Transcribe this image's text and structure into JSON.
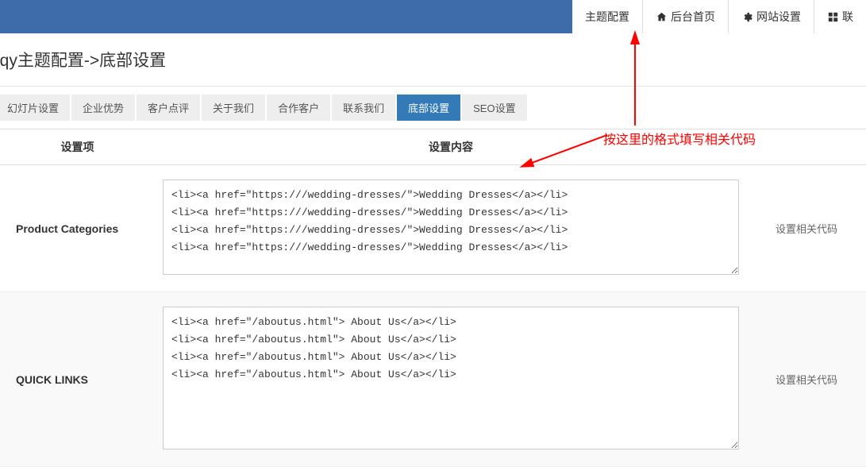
{
  "topTabs": [
    {
      "label": "主题配置",
      "icon": ""
    },
    {
      "label": "后台首页",
      "icon": "home"
    },
    {
      "label": "网站设置",
      "icon": "gear"
    },
    {
      "label": "联",
      "icon": "grid"
    }
  ],
  "pageTitle": "iqy主题配置->底部设置",
  "settingTabs": [
    {
      "label": "幻灯片设置",
      "active": false
    },
    {
      "label": "企业优势",
      "active": false
    },
    {
      "label": "客户点评",
      "active": false
    },
    {
      "label": "关于我们",
      "active": false
    },
    {
      "label": "合作客户",
      "active": false
    },
    {
      "label": "联系我们",
      "active": false
    },
    {
      "label": "底部设置",
      "active": true
    },
    {
      "label": "SEO设置",
      "active": false
    }
  ],
  "tableHeaders": {
    "col1": "设置项",
    "col2": "设置内容"
  },
  "rows": [
    {
      "label": "Product Categories",
      "content": "<li><a href=\"https:///wedding-dresses/\">Wedding Dresses</a></li>\n<li><a href=\"https:///wedding-dresses/\">Wedding Dresses</a></li>\n<li><a href=\"https:///wedding-dresses/\">Wedding Dresses</a></li>\n<li><a href=\"https:///wedding-dresses/\">Wedding Dresses</a></li>",
      "note": "设置相关代码"
    },
    {
      "label": "QUICK LINKS",
      "content": "<li><a href=\"/aboutus.html\"> About Us</a></li>\n<li><a href=\"/aboutus.html\"> About Us</a></li>\n<li><a href=\"/aboutus.html\"> About Us</a></li>\n<li><a href=\"/aboutus.html\"> About Us</a></li>",
      "note": "设置相关代码"
    }
  ],
  "annotationText": "按这里的格式填写相关代码"
}
